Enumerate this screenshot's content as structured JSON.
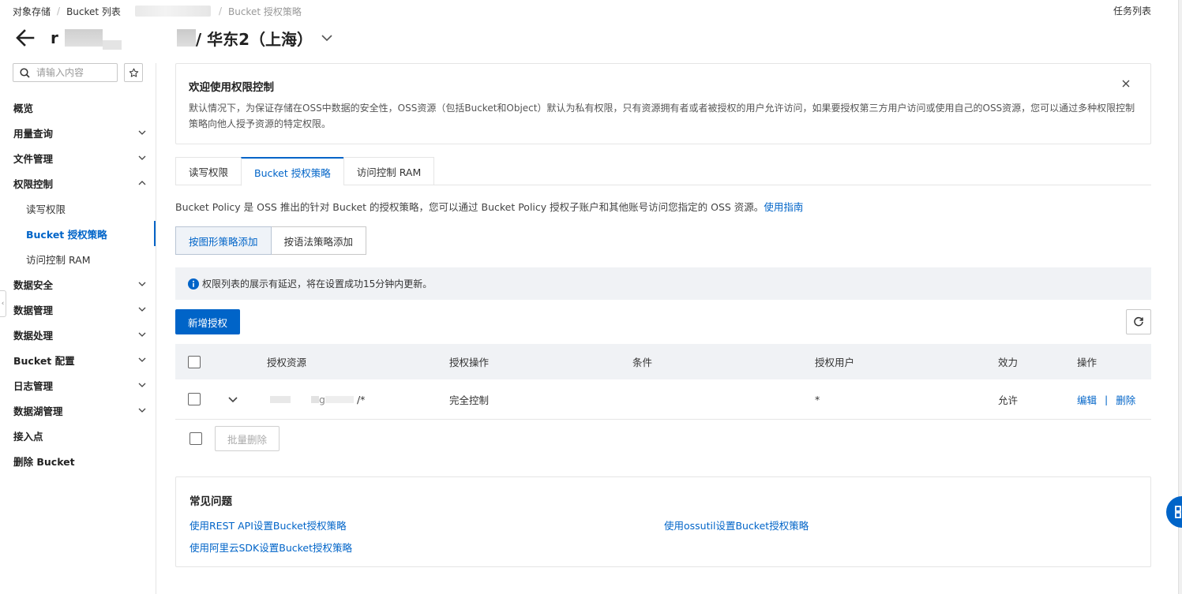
{
  "breadcrumb": {
    "items": [
      "对象存储",
      "Bucket 列表"
    ],
    "current": "Bucket 授权策略"
  },
  "header": {
    "title_prefix": "r",
    "region": "/ 华东2（上海）",
    "task_list": "任务列表"
  },
  "sidebar": {
    "search_placeholder": "请输入内容",
    "items": [
      {
        "label": "概览",
        "has_arrow": false
      },
      {
        "label": "用量查询",
        "has_arrow": true
      },
      {
        "label": "文件管理",
        "has_arrow": true
      },
      {
        "label": "权限控制",
        "has_arrow": true,
        "expanded": true
      },
      {
        "label": "数据安全",
        "has_arrow": true
      },
      {
        "label": "数据管理",
        "has_arrow": true
      },
      {
        "label": "数据处理",
        "has_arrow": true
      },
      {
        "label": "Bucket 配置",
        "has_arrow": true
      },
      {
        "label": "日志管理",
        "has_arrow": true
      },
      {
        "label": "数据湖管理",
        "has_arrow": true
      },
      {
        "label": "接入点",
        "has_arrow": false
      },
      {
        "label": "删除 Bucket",
        "has_arrow": false
      }
    ],
    "sub_items": [
      "读写权限",
      "Bucket 授权策略",
      "访问控制 RAM"
    ],
    "active_sub": "Bucket 授权策略"
  },
  "welcome": {
    "title": "欢迎使用权限控制",
    "body": "默认情况下，为保证存储在OSS中数据的安全性，OSS资源（包括Bucket和Object）默认为私有权限，只有资源拥有者或者被授权的用户允许访问，如果要授权第三方用户访问或使用自己的OSS资源，您可以通过多种权限控制策略向他人授予资源的特定权限。"
  },
  "tabs": [
    "读写权限",
    "Bucket 授权策略",
    "访问控制 RAM"
  ],
  "active_tab": "Bucket 授权策略",
  "policy": {
    "description": "Bucket Policy 是 OSS 推出的针对 Bucket 的授权策略，您可以通过 Bucket Policy 授权子账户和其他账号访问您指定的 OSS 资源。",
    "guide_link": "使用指南"
  },
  "mode_buttons": [
    "按图形策略添加",
    "按语法策略添加"
  ],
  "notice": "权限列表的展示有延迟，将在设置成功15分钟内更新。",
  "add_button": "新增授权",
  "table": {
    "headers": [
      "授权资源",
      "授权操作",
      "条件",
      "授权用户",
      "效力",
      "操作"
    ],
    "rows": [
      {
        "resource_suffix": "g",
        "resource_end": "/*",
        "action": "完全控制",
        "condition": "",
        "user": "*",
        "effect": "允许",
        "edit": "编辑",
        "delete": "删除",
        "op_sep": "|"
      }
    ]
  },
  "batch_delete": "批量删除",
  "faq": {
    "title": "常见问题",
    "links": [
      "使用REST API设置Bucket授权策略",
      "使用ossutil设置Bucket授权策略",
      "使用阿里云SDK设置Bucket授权策略"
    ]
  },
  "colors": {
    "accent": "#0064c8",
    "notice_bg": "#f0f2f5"
  }
}
